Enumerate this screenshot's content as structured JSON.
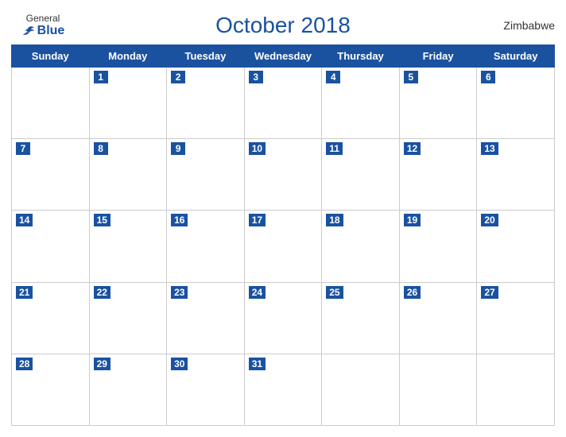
{
  "header": {
    "logo_general": "General",
    "logo_blue": "Blue",
    "title": "October 2018",
    "country": "Zimbabwe"
  },
  "days_of_week": [
    "Sunday",
    "Monday",
    "Tuesday",
    "Wednesday",
    "Thursday",
    "Friday",
    "Saturday"
  ],
  "weeks": [
    [
      null,
      1,
      2,
      3,
      4,
      5,
      6
    ],
    [
      7,
      8,
      9,
      10,
      11,
      12,
      13
    ],
    [
      14,
      15,
      16,
      17,
      18,
      19,
      20
    ],
    [
      21,
      22,
      23,
      24,
      25,
      26,
      27
    ],
    [
      28,
      29,
      30,
      31,
      null,
      null,
      null
    ]
  ]
}
